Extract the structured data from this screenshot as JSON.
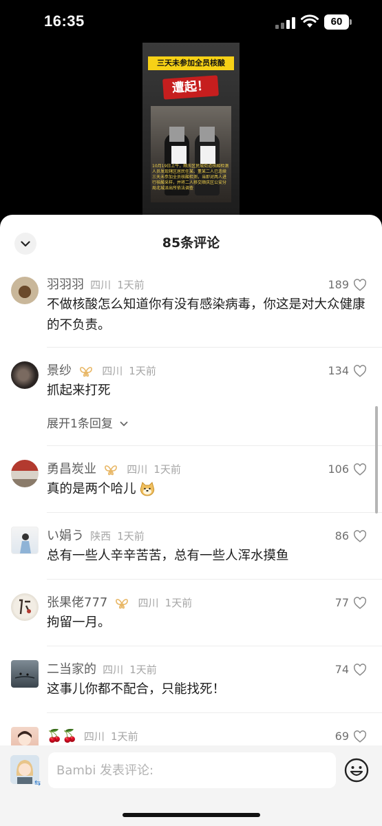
{
  "status_bar": {
    "time": "16:35",
    "battery": "60"
  },
  "video": {
    "title": "三天未参加全员核酸",
    "headline": "遭起！",
    "caption": "10月19日上午，顺庆区民城街道核酸检测人员发现辖区居民任某、董某二人已连续三天未参加全员核酸检测，当即对两人进行核酸采样，并将二人移交顺庆区公安分局北城派出所依法调查"
  },
  "sheet": {
    "title": "85条评论"
  },
  "comments": [
    {
      "name": "羽羽羽",
      "location": "四川",
      "time": "1天前",
      "likes": "189",
      "badge": false,
      "text": "不做核酸怎么知道你有没有感染病毒，你这是对大众健康的不负责。"
    },
    {
      "name": "景纱",
      "location": "四川",
      "time": "1天前",
      "likes": "134",
      "badge": true,
      "text": "抓起来打死",
      "expand": "展开1条回复"
    },
    {
      "name": "勇昌炭业",
      "location": "四川",
      "time": "1天前",
      "likes": "106",
      "badge": true,
      "text": "真的是两个哈儿"
    },
    {
      "name": "い娟う",
      "location": "陕西",
      "time": "1天前",
      "likes": "86",
      "badge": false,
      "text": "总有一些人辛辛苦苦，总有一些人浑水摸鱼"
    },
    {
      "name": "张果佬777",
      "location": "四川",
      "time": "1天前",
      "likes": "77",
      "badge": true,
      "text": "拘留一月。"
    },
    {
      "name": "二当家的",
      "location": "四川",
      "time": "1天前",
      "likes": "74",
      "badge": false,
      "text": "这事儿你都不配合，只能找死！"
    },
    {
      "name": "🍒🍒",
      "location": "四川",
      "time": "1天前",
      "likes": "69",
      "badge": false
    }
  ],
  "input": {
    "placeholder": "Bambi 发表评论:"
  },
  "colors": {
    "badge": "#e8b766",
    "accent": "#2c78c9"
  }
}
